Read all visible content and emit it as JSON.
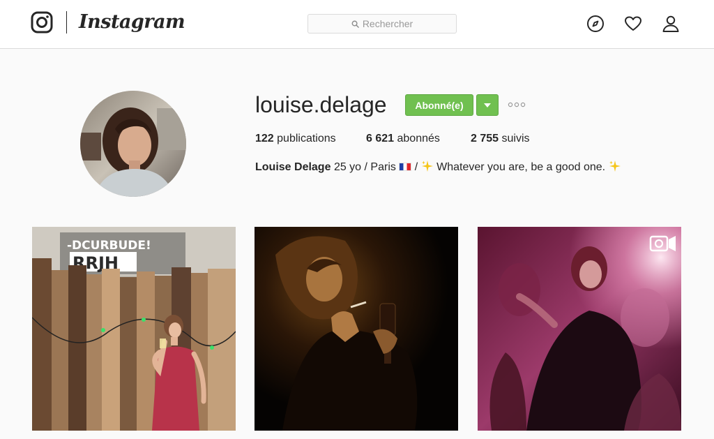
{
  "header": {
    "app_name": "Instagram",
    "search": {
      "placeholder": "Rechercher",
      "icon": "search-icon"
    },
    "nav_icons": [
      "explore-compass-icon",
      "activity-heart-icon",
      "profile-person-icon"
    ]
  },
  "profile": {
    "username": "louise.delage",
    "follow_button_label": "Abonné(e)",
    "stats": {
      "posts_count": "122",
      "posts_label": "publications",
      "followers_count": "6 621",
      "followers_label": "abonnés",
      "following_count": "2 755",
      "following_label": "suivis"
    },
    "bio": {
      "full_name": "Louise Delage",
      "text_part1": "25 yo / Paris",
      "separator": "/",
      "text_part2": "Whatever you are, be a good one."
    }
  },
  "posts": [
    {
      "kind": "photo",
      "graffiti_line1": "-DCURBUDE!",
      "graffiti_line2": "RRJH"
    },
    {
      "kind": "photo"
    },
    {
      "kind": "video",
      "badge_icon": "video-camera-icon"
    }
  ],
  "colors": {
    "follow_green": "#70c050",
    "border": "#dbdbdb",
    "background": "#fafafa"
  }
}
